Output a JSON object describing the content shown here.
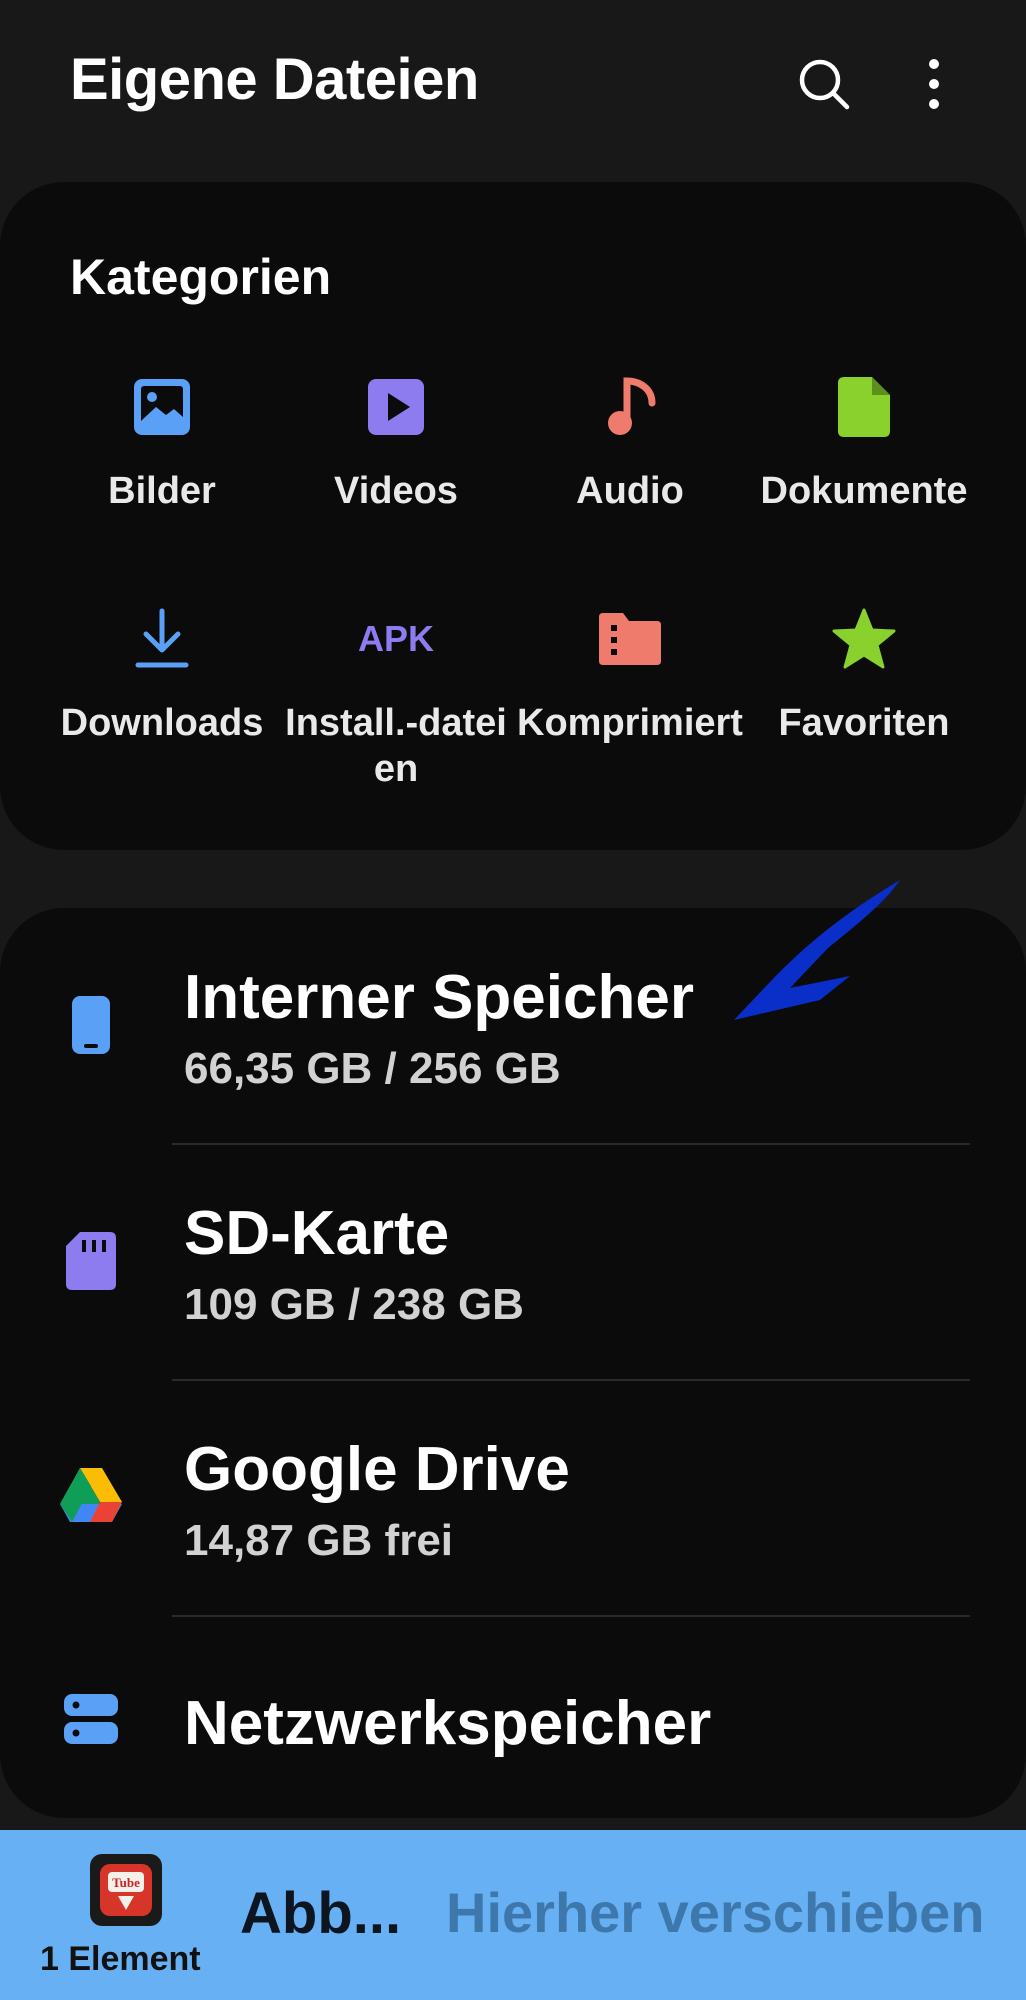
{
  "header": {
    "title": "Eigene Dateien",
    "search_icon": "search-icon",
    "more_icon": "more-vertical-icon"
  },
  "categories": {
    "heading": "Kategorien",
    "items": [
      {
        "label": "Bilder",
        "icon": "image-icon",
        "color": "#5aa0f6"
      },
      {
        "label": "Videos",
        "icon": "video-icon",
        "color": "#8c7cf0"
      },
      {
        "label": "Audio",
        "icon": "music-note-icon",
        "color": "#ef7b6c"
      },
      {
        "label": "Dokumente",
        "icon": "document-icon",
        "color": "#8bd12e"
      },
      {
        "label": "Downloads",
        "icon": "download-icon",
        "color": "#5aa0f6"
      },
      {
        "label": "Install.-dateien",
        "icon": "apk-icon",
        "icon_text": "APK",
        "color": "#8c7cf0"
      },
      {
        "label": "Komprimiert",
        "icon": "compressed-folder-icon",
        "color": "#ef7b6c"
      },
      {
        "label": "Favoriten",
        "icon": "star-icon",
        "color": "#8bd12e"
      }
    ]
  },
  "storage": {
    "items": [
      {
        "name": "Interner Speicher",
        "detail": "66,35 GB / 256 GB",
        "icon": "phone-icon",
        "color": "#5aa0f6"
      },
      {
        "name": "SD-Karte",
        "detail": "109 GB / 238 GB",
        "icon": "sd-card-icon",
        "color": "#8c7cf0"
      },
      {
        "name": "Google Drive",
        "detail": "14,87 GB frei",
        "icon": "google-drive-icon"
      },
      {
        "name": "Netzwerkspeicher",
        "detail": "",
        "icon": "network-storage-icon",
        "color": "#5aa0f6"
      }
    ]
  },
  "annotation": {
    "color": "#0a2fc8"
  },
  "bottom_bar": {
    "app_icon": "tubemate-app-icon",
    "count_label": "1 Element",
    "cancel_label": "Abb...",
    "move_label": "Hierher verschieben",
    "background": "#68b0f4"
  }
}
